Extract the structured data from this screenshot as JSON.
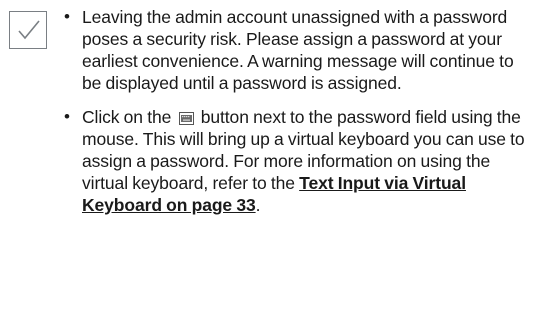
{
  "notes": [
    {
      "text": "Leaving the admin account unassigned with a password poses a security risk. Please assign a password at your earliest convenience. A warning message will continue to be displayed until a password is assigned."
    },
    {
      "text_before_icon": "Click on the",
      "icon": "keyboard-icon",
      "text_after_icon": "button next to the password field using the mouse. This will bring up a virtual keyboard you can use to assign a password. For more information on using the virtual keyboard, refer to the",
      "link_text": "Text Input via Virtual Keyboard on page 33",
      "text_end": "."
    }
  ],
  "colors": {
    "check": "#7a7f84",
    "text": "#1a1a1a"
  }
}
